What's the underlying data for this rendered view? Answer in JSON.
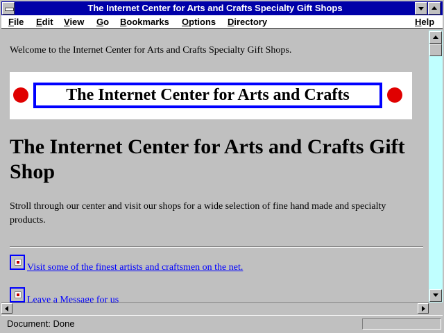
{
  "window": {
    "title": "The Internet Center for Arts and Crafts Specialty Gift Shops"
  },
  "menu": {
    "items": [
      "File",
      "Edit",
      "View",
      "Go",
      "Bookmarks",
      "Options",
      "Directory",
      "Help"
    ]
  },
  "page": {
    "welcome": "Welcome to the Internet Center for Arts and Crafts Specialty Gift Shops.",
    "banner_text": "The Internet Center for Arts and Crafts",
    "heading": "The Internet Center for Arts and Crafts Gift Shop",
    "intro": "Stroll through our center and visit our shops for a wide selection of fine hand made and specialty products.",
    "links": [
      "Visit some of the finest artists and craftsmen on the net.",
      "Leave a Message for us"
    ]
  },
  "status": {
    "text": "Document: Done"
  },
  "colors": {
    "titlebar": "#0000a8",
    "link": "#0000ff",
    "banner_dot": "#e00000",
    "scroll_track": "#c0ffff"
  },
  "icons": [
    "system-menu-icon",
    "minimize-icon",
    "maximize-icon",
    "broken-image-icon"
  ]
}
